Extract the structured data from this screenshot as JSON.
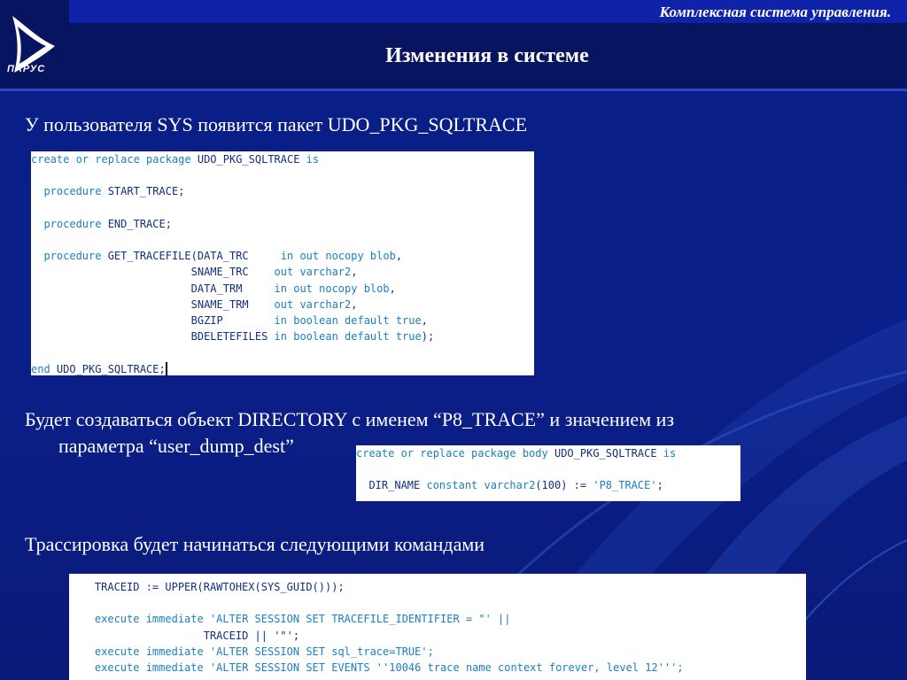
{
  "header": {
    "tagline": "Комплексная система управления.",
    "title": "Изменения в системе",
    "logo_text": "ПАРУС"
  },
  "paragraphs": {
    "p1": "У пользователя SYS появится пакет UDO_PKG_SQLTRACE",
    "p2_line1": "Будет создаваться объект DIRECTORY с именем “P8_TRACE” и значением из",
    "p2_line2": "параметра “user_dump_dest”",
    "p3": "Трассировка будет начинаться следующими командами"
  },
  "code1": {
    "l1a": "create or replace package ",
    "l1b": "UDO_PKG_SQLTRACE",
    "l1c": " is",
    "l2a": "procedure ",
    "l2b": "START_TRACE;",
    "l3a": "procedure ",
    "l3b": "END_TRACE;",
    "l4a": "procedure ",
    "l4b": "GET_TRACEFILE(DATA_TRC     ",
    "l4c": "in out nocopy blob",
    "l5a": "SNAME_TRC    ",
    "l5b": "out varchar2",
    "l6a": "DATA_TRM     ",
    "l6b": "in out nocopy blob",
    "l7a": "SNAME_TRM    ",
    "l7b": "out varchar2",
    "l8a": "BGZIP        ",
    "l8b": "in boolean default true",
    "l9a": "BDELETEFILES ",
    "l9b": "in boolean default true",
    "l10a": "end ",
    "l10b": "UDO_PKG_SQLTRACE;"
  },
  "code2": {
    "l1a": "create or replace package body ",
    "l1b": "UDO_PKG_SQLTRACE",
    "l1c": " is",
    "l2a": "DIR_NAME ",
    "l2b": "constant varchar2",
    "l2c": "(100)",
    "l2d": " := ",
    "l2e": "'P8_TRACE'",
    "l2f": ";"
  },
  "code3": {
    "l1": "TRACEID := UPPER(RAWTOHEX(SYS_GUID()));",
    "l2a": "execute immediate ",
    "l2b": "'ALTER SESSION SET TRACEFILE_IDENTIFIER = \"' ||",
    "l3": "TRACEID || '\"';",
    "l4a": "execute immediate ",
    "l4b": "'ALTER SESSION SET sql_trace=TRUE';",
    "l5a": "execute immediate ",
    "l5b": "'ALTER SESSION SET EVENTS ''10046 trace name context forever, level 12''';"
  },
  "colors": {
    "background": "#0b1f8a",
    "header": "#071560",
    "accent": "#1a7fc4"
  }
}
